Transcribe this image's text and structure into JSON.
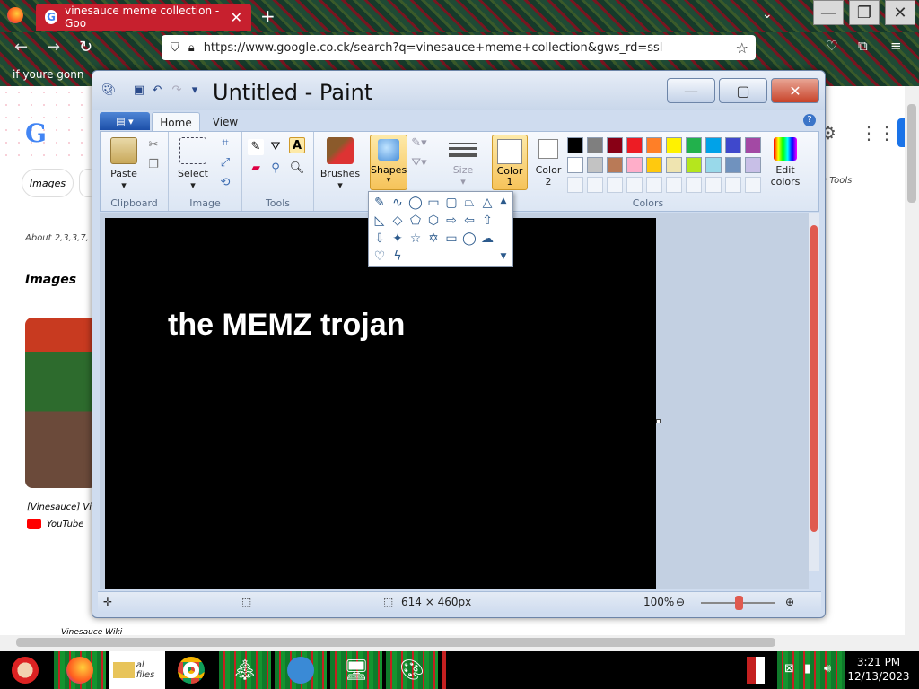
{
  "browser": {
    "tab_title": "vinesauce meme collection - Goo",
    "tab_close": "✕",
    "new_tab": "+",
    "url": "https://www.google.co.ck/search?q=vinesauce+meme+collection&gws_rd=ssl",
    "bookmark": "if youre gonn"
  },
  "google": {
    "chip1": "Images",
    "about": "About 2,3,3,7,",
    "images_heading": "Images",
    "thumb_caption": "[Vinesauce] Vin",
    "source": "YouTube",
    "filter": "Tools",
    "bottom_text": "Vinesauce Wiki"
  },
  "paint": {
    "title": "Untitled - Paint",
    "tabs": {
      "home": "Home",
      "view": "View"
    },
    "groups": {
      "clipboard": "Clipboard",
      "image": "Image",
      "tools": "Tools",
      "colors": "Colors"
    },
    "buttons": {
      "paste": "Paste",
      "select": "Select",
      "brushes": "Brushes",
      "shapes": "Shapes",
      "size": "Size",
      "color1_a": "Color",
      "color1_b": "1",
      "color2_a": "Color",
      "color2_b": "2",
      "edit_colors_a": "Edit",
      "edit_colors_b": "colors"
    },
    "palette_row1": [
      "#000000",
      "#7f7f7f",
      "#880015",
      "#ed1c24",
      "#ff7f27",
      "#fff200",
      "#22b14c",
      "#00a2e8",
      "#3f48cc",
      "#a349a4"
    ],
    "palette_row2": [
      "#ffffff",
      "#c3c3c3",
      "#b97a57",
      "#ffaec9",
      "#ffc90e",
      "#efe4b0",
      "#b5e61d",
      "#99d9ea",
      "#7092be",
      "#c8bfe7"
    ],
    "canvas_text": "the MEMZ trojan",
    "status": {
      "dimensions": "614 × 460px",
      "zoom": "100%"
    }
  },
  "taskbar": {
    "clock_time": "3:21 PM",
    "clock_date": "12/13/2023",
    "explorer_label": "al files"
  }
}
